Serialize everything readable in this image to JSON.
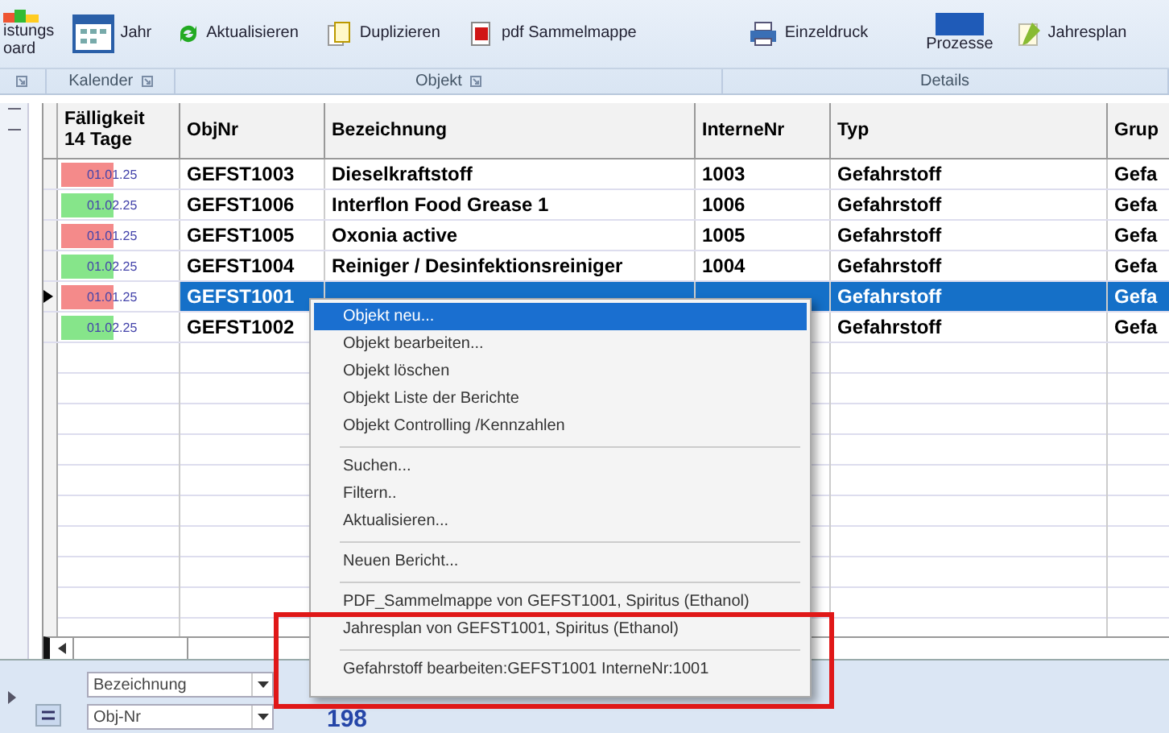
{
  "ribbon": {
    "items": [
      {
        "label": "istungs\noard",
        "kind": "stacked"
      },
      {
        "label": "Jahr",
        "kind": "big"
      },
      {
        "label": "Aktualisieren",
        "kind": "small"
      },
      {
        "label": "Duplizieren",
        "kind": "small"
      },
      {
        "label": "pdf Sammelmappe",
        "kind": "small"
      },
      {
        "label": "Einzeldruck",
        "kind": "small"
      },
      {
        "label": "Prozesse",
        "kind": "stacked"
      },
      {
        "label": "Jahresplan",
        "kind": "small"
      }
    ],
    "groups": [
      {
        "label": "Kalender"
      },
      {
        "label": "Objekt"
      },
      {
        "label": "Details"
      }
    ]
  },
  "table": {
    "columns": [
      {
        "label": "Fälligkeit\n14 Tage"
      },
      {
        "label": "ObjNr"
      },
      {
        "label": "Bezeichnung"
      },
      {
        "label": "InterneNr"
      },
      {
        "label": "Typ"
      },
      {
        "label": "Grup"
      }
    ],
    "rows": [
      {
        "due": "01.01.25",
        "color": "#f48a8a",
        "objnr": "GEFST1003",
        "bezeichnung": "Dieselkraftstoff",
        "internenr": "1003",
        "typ": "Gefahrstoff",
        "gruppe": "Gefa",
        "selected": false
      },
      {
        "due": "01.02.25",
        "color": "#86e58a",
        "objnr": "GEFST1006",
        "bezeichnung": "Interflon Food Grease 1",
        "internenr": "1006",
        "typ": "Gefahrstoff",
        "gruppe": "Gefa",
        "selected": false
      },
      {
        "due": "01.01.25",
        "color": "#f48a8a",
        "objnr": "GEFST1005",
        "bezeichnung": "Oxonia active",
        "internenr": "1005",
        "typ": "Gefahrstoff",
        "gruppe": "Gefa",
        "selected": false
      },
      {
        "due": "01.02.25",
        "color": "#86e58a",
        "objnr": "GEFST1004",
        "bezeichnung": "Reiniger / Desinfektionsreiniger",
        "internenr": "1004",
        "typ": "Gefahrstoff",
        "gruppe": "Gefa",
        "selected": false
      },
      {
        "due": "01.01.25",
        "color": "#f48a8a",
        "objnr": "GEFST1001",
        "typ": "Gefahrstoff",
        "gruppe": "Gefa",
        "selected": true
      },
      {
        "due": "01.02.25",
        "color": "#86e58a",
        "objnr": "GEFST1002",
        "typ": "Gefahrstoff",
        "gruppe": "Gefa",
        "selected": false
      }
    ]
  },
  "context_menu": {
    "items": [
      {
        "kind": "item",
        "label": "Objekt neu...",
        "selected": true
      },
      {
        "kind": "item",
        "label": "Objekt bearbeiten...",
        "selected": false
      },
      {
        "kind": "item",
        "label": "Objekt löschen",
        "selected": false
      },
      {
        "kind": "item",
        "label": "Objekt Liste der Berichte",
        "selected": false
      },
      {
        "kind": "item",
        "label": "Objekt Controlling /Kennzahlen",
        "selected": false
      },
      {
        "kind": "separator"
      },
      {
        "kind": "item",
        "label": "Suchen...",
        "selected": false
      },
      {
        "kind": "item",
        "label": "Filtern..",
        "selected": false
      },
      {
        "kind": "item",
        "label": "Aktualisieren...",
        "selected": false
      },
      {
        "kind": "separator"
      },
      {
        "kind": "item",
        "label": "Neuen Bericht...",
        "selected": false
      },
      {
        "kind": "separator"
      },
      {
        "kind": "item",
        "label": "PDF_Sammelmappe von GEFST1001, Spiritus (Ethanol)",
        "selected": false
      },
      {
        "kind": "item",
        "label": "Jahresplan von GEFST1001, Spiritus (Ethanol)",
        "selected": false
      },
      {
        "kind": "separator"
      },
      {
        "kind": "item",
        "label": "Gefahrstoff bearbeiten:GEFST1001 InterneNr:1001",
        "selected": false
      }
    ]
  },
  "bottom": {
    "sort_fields": [
      {
        "value": "Bezeichnung"
      },
      {
        "value": "Obj-Nr"
      }
    ],
    "count": "198"
  }
}
